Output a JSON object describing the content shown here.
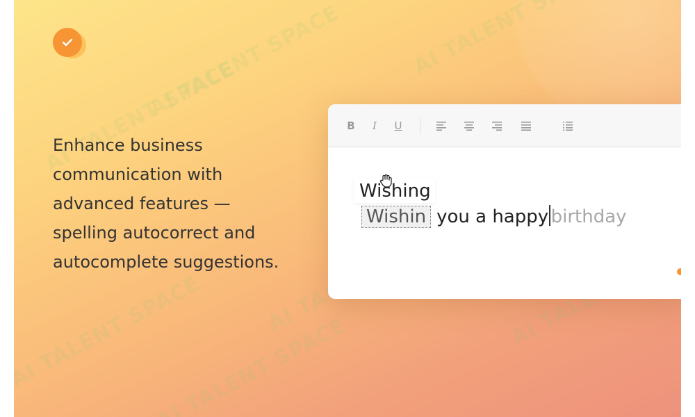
{
  "headline": {
    "lines": [
      "Enhance business",
      "communication with",
      "advanced features —",
      "spelling autocorrect and",
      "autocomplete suggestions."
    ]
  },
  "watermark": {
    "text": "AI TALENT SPACE"
  },
  "editor": {
    "toolbar": {
      "bold_label": "B",
      "italic_label": "I",
      "underline_label": "U",
      "icons": [
        "bold-icon",
        "italic-icon",
        "underline-icon",
        "align-left-icon",
        "align-center-icon",
        "align-right-icon",
        "align-justify-icon",
        "bullet-list-icon"
      ]
    },
    "suggestion": "Wishing",
    "misspelled_word": "Wishin",
    "typed_text": "you a happy",
    "autocomplete_text": "birthday"
  },
  "colors": {
    "accent": "#f79434",
    "badge_secondary": "#fcc25c",
    "gradient_start": "#fde58a",
    "gradient_end": "#ee927c"
  }
}
